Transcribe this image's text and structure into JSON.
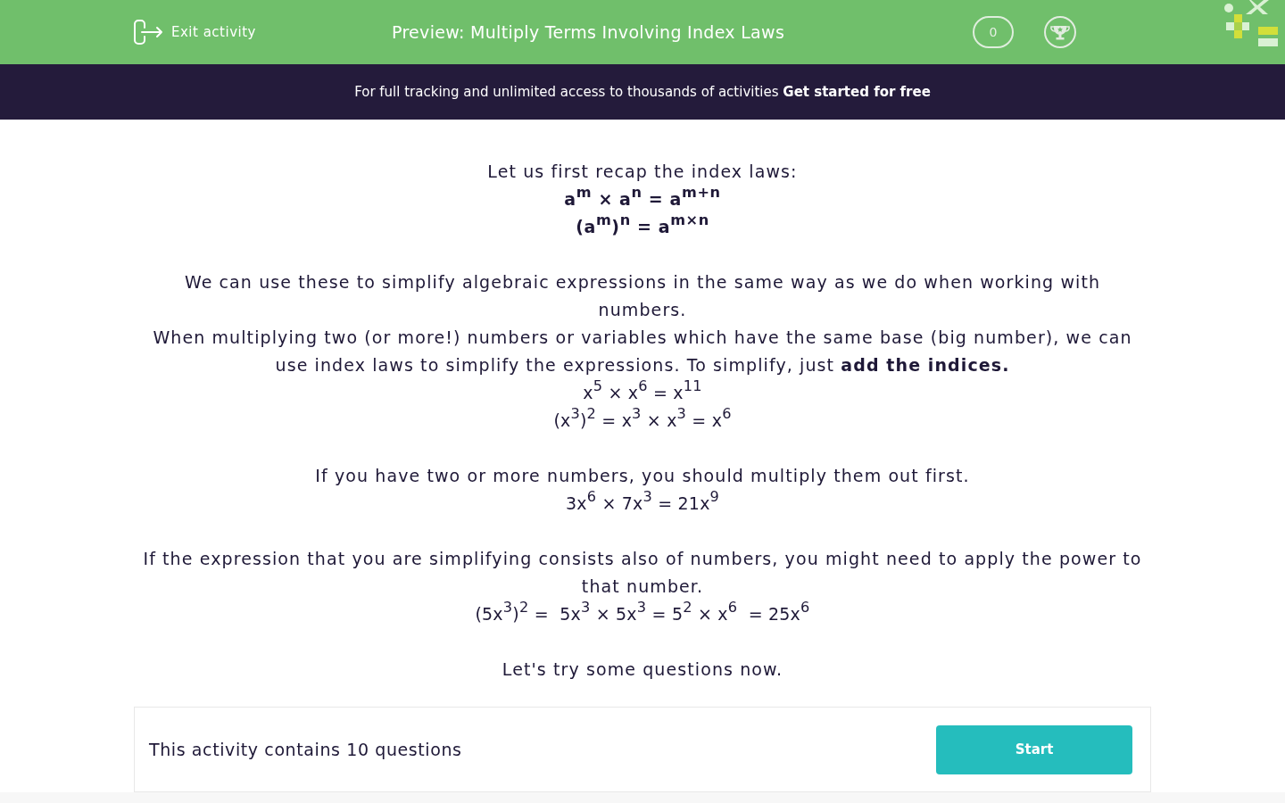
{
  "header": {
    "exit_label": "Exit activity",
    "title": "Preview: Multiply Terms Involving Index Laws",
    "score": "0"
  },
  "banner": {
    "text": "For full tracking and unlimited access to thousands of activities",
    "link": "Get started for free"
  },
  "lesson": [
    {
      "lines": [
        {
          "kind": "text",
          "text": "Let us first recap the index laws:"
        },
        {
          "kind": "law",
          "text": "a$^{m}$ × a$^{n}$ = a$^{m+n}$"
        },
        {
          "kind": "law",
          "text": "(a$^{m}$)$^{n}$ = a$^{m×n}$"
        }
      ]
    },
    {
      "lines": [
        {
          "kind": "text",
          "text": "We can use these to simplify algebraic expressions in the same way as we do when working with numbers."
        },
        {
          "kind": "text",
          "text": "When multiplying two (or more!) numbers or variables which have the same base (big number), we can use index laws to simplify the expressions. To simplify, just **add the indices.**"
        },
        {
          "kind": "formula",
          "text": "x$^{5}$ × x$^{6}$ = x$^{11}$"
        },
        {
          "kind": "formula",
          "text": "(x$^{3}$)$^{2}$ = x$^{3}$ × x$^{3}$ = x$^{6}$"
        }
      ]
    },
    {
      "lines": [
        {
          "kind": "text",
          "text": "If you have two or more numbers, you should multiply them out first."
        },
        {
          "kind": "formula",
          "text": "3x$^{6}$ × 7x$^{3}$ = 21x$^{9}$"
        }
      ]
    },
    {
      "lines": [
        {
          "kind": "text",
          "text": "If the expression that you are simplifying consists also of numbers, you might need to apply the power to that number."
        },
        {
          "kind": "formula",
          "text": "(5x$^{3}$)$^{2}$ =  5x$^{3}$ × 5x$^{3}$ = 5$^{2}$ × x$^{6}$  = 25x$^{6}$"
        }
      ]
    },
    {
      "lines": [
        {
          "kind": "text",
          "text": "Let's try some questions now."
        }
      ]
    }
  ],
  "activity": {
    "summary": "This activity contains 10 questions",
    "button": "Start"
  }
}
